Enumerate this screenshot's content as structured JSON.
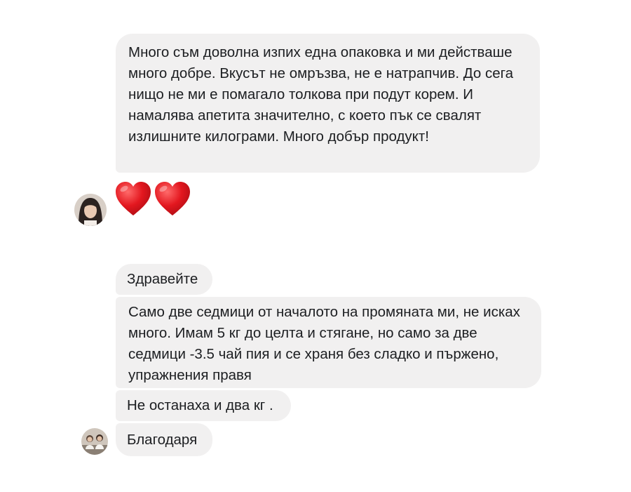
{
  "conversation_1": {
    "message": "Много съм доволна изпих една опаковка и ми действаше много добре. Вкусът не омръзва, не е натрапчив. До сега нищо не ми е помагало толкова при подут корем. И намалява апетита значително, с което пък се свалят излишните килограми. Много добър продукт!",
    "reaction": "❤️❤️",
    "reaction_color": "#e0171f"
  },
  "conversation_2": {
    "messages": [
      "Здравейте",
      "Само две седмици от началото на промяната ми, не исках много. Имам 5 кг до целта и стягане, но само за две седмици -3.5 чай пия и се храня без сладко и пържено, упражнения правя",
      "Не останаха и два кг .",
      "Благодаря"
    ]
  },
  "colors": {
    "bubble": "#f1f0f0",
    "text": "#1c1e21",
    "background": "#ffffff"
  }
}
